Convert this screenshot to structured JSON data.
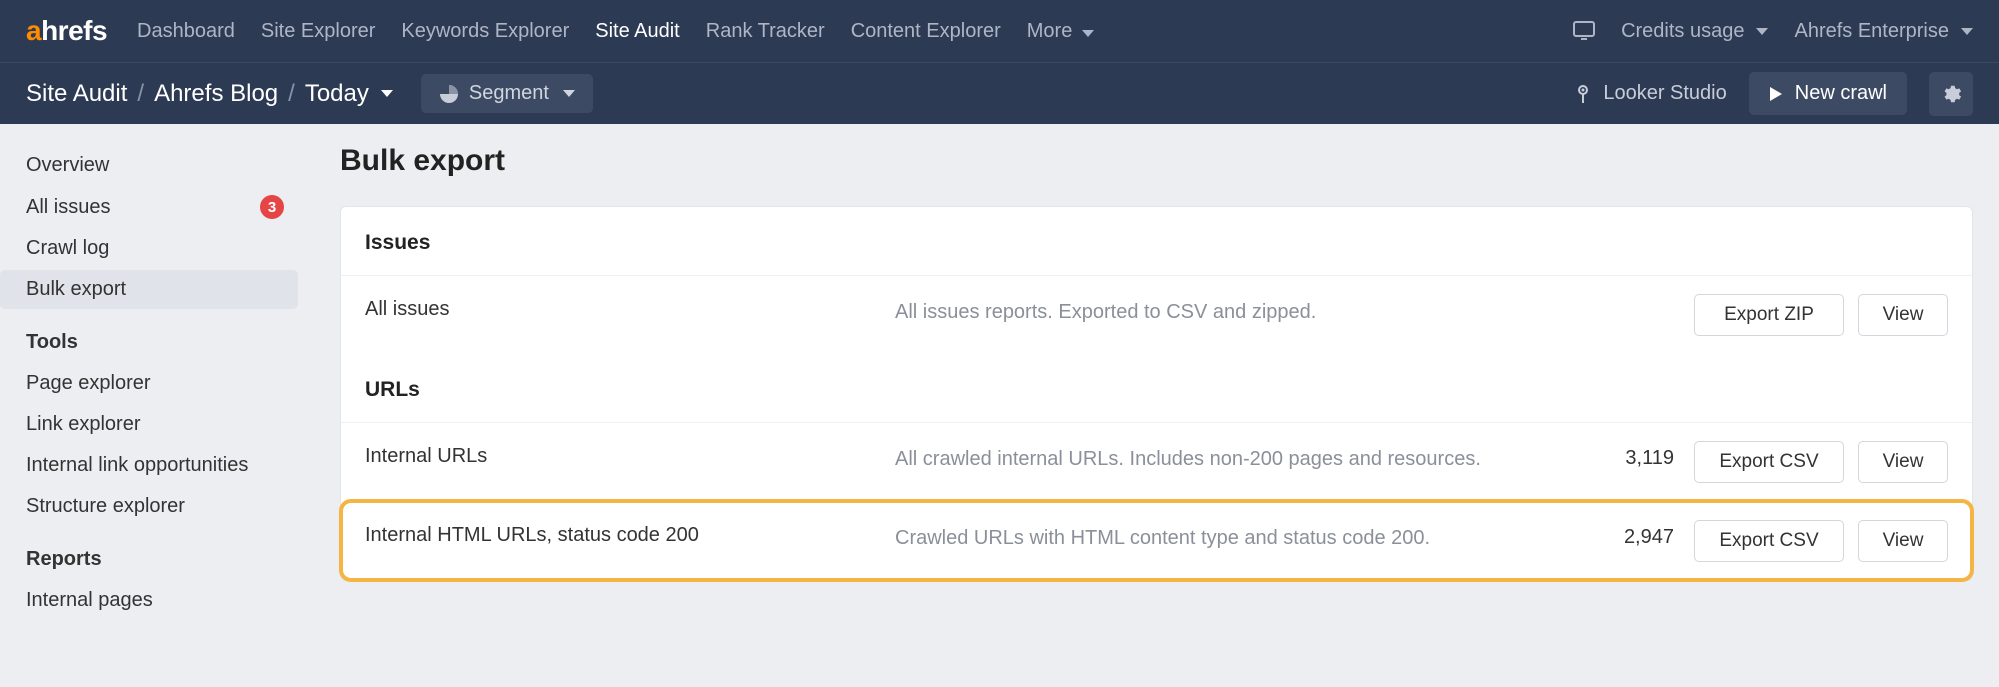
{
  "logo": {
    "first": "a",
    "rest": "hrefs"
  },
  "nav": {
    "items": [
      "Dashboard",
      "Site Explorer",
      "Keywords Explorer",
      "Site Audit",
      "Rank Tracker",
      "Content Explorer"
    ],
    "more": "More",
    "active": "Site Audit"
  },
  "nav_right": {
    "credits": "Credits usage",
    "account": "Ahrefs Enterprise"
  },
  "breadcrumb": {
    "root": "Site Audit",
    "project": "Ahrefs Blog",
    "date": "Today"
  },
  "segment_label": "Segment",
  "looker_label": "Looker Studio",
  "newcrawl_label": "New crawl",
  "sidebar": {
    "items": [
      {
        "label": "Overview",
        "selected": false
      },
      {
        "label": "All issues",
        "selected": false,
        "badge": "3"
      },
      {
        "label": "Crawl log",
        "selected": false
      },
      {
        "label": "Bulk export",
        "selected": true
      }
    ],
    "tools_heading": "Tools",
    "tools": [
      "Page explorer",
      "Link explorer",
      "Internal link opportunities",
      "Structure explorer"
    ],
    "reports_heading": "Reports",
    "reports": [
      "Internal pages"
    ]
  },
  "page_title": "Bulk export",
  "sections": {
    "issues": {
      "title": "Issues",
      "rows": [
        {
          "name": "All issues",
          "desc": "All issues reports. Exported to CSV and zipped.",
          "count": "",
          "export_label": "Export ZIP",
          "view_label": "View"
        }
      ]
    },
    "urls": {
      "title": "URLs",
      "rows": [
        {
          "name": "Internal URLs",
          "desc": "All crawled internal URLs. Includes non-200 pages and resources.",
          "count": "3,119",
          "export_label": "Export CSV",
          "view_label": "View"
        },
        {
          "name": "Internal HTML URLs, status code 200",
          "desc": "Crawled URLs with HTML content type and status code 200.",
          "count": "2,947",
          "export_label": "Export CSV",
          "view_label": "View",
          "highlighted": true
        }
      ]
    }
  }
}
